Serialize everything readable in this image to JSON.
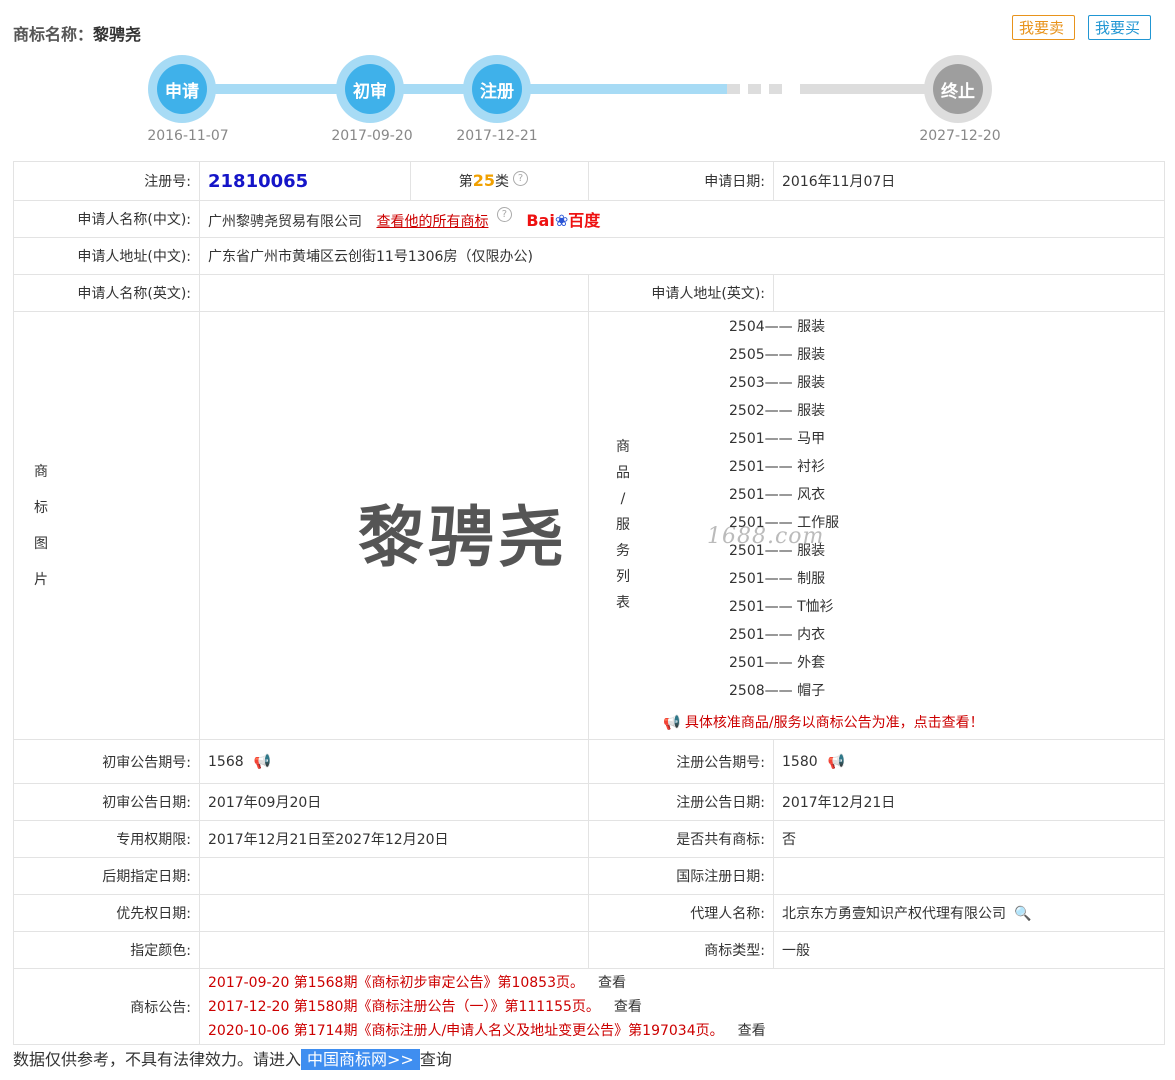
{
  "header": {
    "title_label": "商标名称：",
    "title_name": "黎骋尧",
    "sell_label": "我要卖",
    "buy_label": "我要买"
  },
  "timeline": [
    {
      "label": "申请",
      "date": "2016-11-07"
    },
    {
      "label": "初审",
      "date": "2017-09-20"
    },
    {
      "label": "注册",
      "date": "2017-12-21"
    },
    {
      "label": "终止",
      "date": "2027-12-20"
    }
  ],
  "info": {
    "reg_no_label": "注册号:",
    "reg_no": "21810065",
    "class_prefix": "第",
    "class_num": "25",
    "class_suffix": "类",
    "apply_date_label": "申请日期:",
    "apply_date": "2016年11月07日",
    "applicant_cn_label": "申请人名称(中文):",
    "applicant_cn": "广州黎骋尧贸易有限公司",
    "view_all_link": "查看他的所有商标",
    "baidu_prefix": "Bai",
    "baidu_suffix": "百度",
    "address_cn_label": "申请人地址(中文):",
    "address_cn": "广东省广州市黄埔区云创街11号1306房（仅限办公)",
    "applicant_en_label": "申请人名称(英文):",
    "applicant_en": "",
    "address_en_label": "申请人地址(英文):",
    "address_en": "",
    "image_label_chars": [
      "商",
      "标",
      "图",
      "片"
    ],
    "trademark_text": "黎骋尧",
    "watermark": "1688.com",
    "goods_label_chars": [
      "商",
      "品",
      "/",
      "服",
      "务",
      "列",
      "表"
    ],
    "goods": [
      {
        "code": "2504",
        "name": "服装"
      },
      {
        "code": "2505",
        "name": "服装"
      },
      {
        "code": "2503",
        "name": "服装"
      },
      {
        "code": "2502",
        "name": "服装"
      },
      {
        "code": "2501",
        "name": "马甲"
      },
      {
        "code": "2501",
        "name": "衬衫"
      },
      {
        "code": "2501",
        "name": "风衣"
      },
      {
        "code": "2501",
        "name": "工作服"
      },
      {
        "code": "2501",
        "name": "服装"
      },
      {
        "code": "2501",
        "name": "制服"
      },
      {
        "code": "2501",
        "name": "T恤衫"
      },
      {
        "code": "2501",
        "name": "内衣"
      },
      {
        "code": "2501",
        "name": "外套"
      },
      {
        "code": "2508",
        "name": "帽子"
      }
    ],
    "goods_separator": "——",
    "goods_notice": "具体核准商品/服务以商标公告为准，点击查看！",
    "prelim_no_label": "初审公告期号:",
    "prelim_no": "1568",
    "reg_pub_no_label": "注册公告期号:",
    "reg_pub_no": "1580",
    "prelim_date_label": "初审公告日期:",
    "prelim_date": "2017年09月20日",
    "reg_pub_date_label": "注册公告日期:",
    "reg_pub_date": "2017年12月21日",
    "exclusive_label": "专用权期限:",
    "exclusive": "2017年12月21日至2027年12月20日",
    "shared_label": "是否共有商标:",
    "shared": "否",
    "later_label": "后期指定日期:",
    "later": "",
    "intl_label": "国际注册日期:",
    "intl": "",
    "priority_label": "优先权日期:",
    "priority": "",
    "agent_label": "代理人名称:",
    "agent": "北京东方勇壹知识产权代理有限公司",
    "color_label": "指定颜色:",
    "color": "",
    "type_label": "商标类型:",
    "type": "一般",
    "ann_label": "商标公告:",
    "announcements": [
      {
        "text": "2017-09-20 第1568期《商标初步审定公告》第10853页。",
        "view": "查看"
      },
      {
        "text": "2017-12-20 第1580期《商标注册公告（一）》第111155页。",
        "view": "查看"
      },
      {
        "text": "2020-10-06 第1714期《商标注册人/申请人名义及地址变更公告》第197034页。",
        "view": "查看"
      }
    ]
  },
  "footer": {
    "prefix": "数据仅供参考，不具有法律效力。请进入",
    "cta": "中国商标网>>",
    "suffix": "查询"
  },
  "colors": {
    "accent_blue": "#3fb1ea",
    "accent_orange": "#e8931c",
    "red_link": "#cc0000"
  }
}
